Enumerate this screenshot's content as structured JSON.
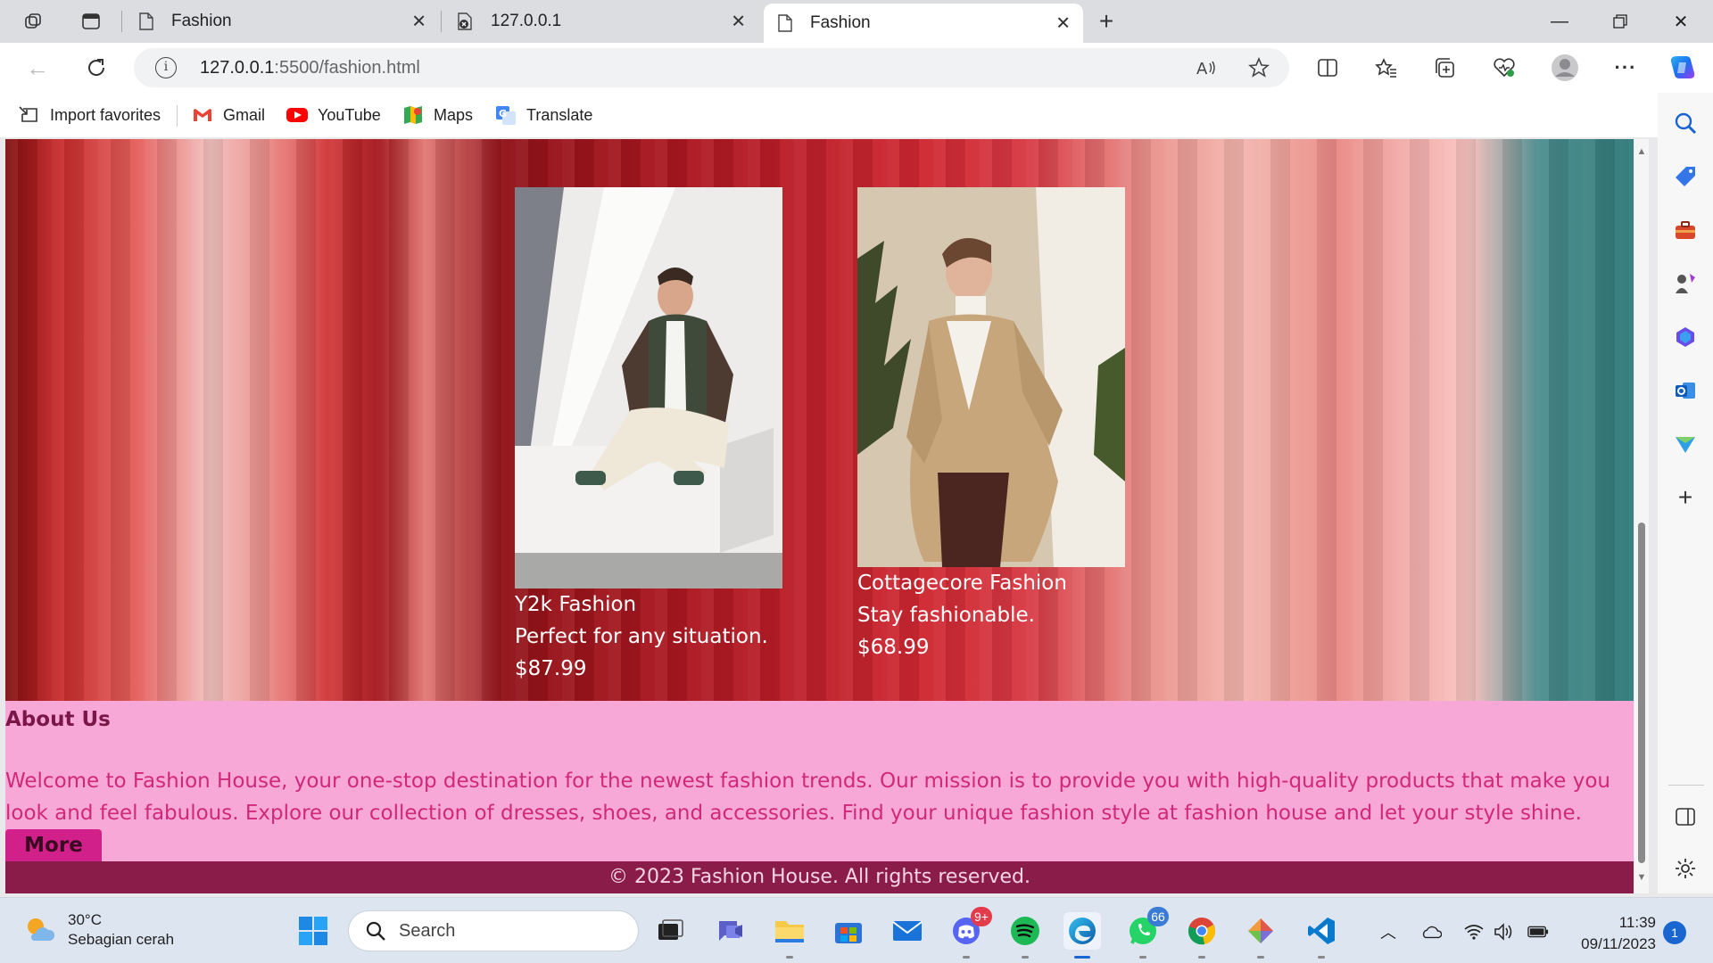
{
  "browser": {
    "tabs": [
      {
        "title": "Fashion",
        "active": false
      },
      {
        "title": "127.0.0.1",
        "active": false
      },
      {
        "title": "Fashion",
        "active": true
      }
    ],
    "address": {
      "host": "127.0.0.1",
      "rest": ":5500/fashion.html"
    },
    "favorites": [
      {
        "label": "Import favorites",
        "icon": "import-favorites-icon"
      },
      {
        "label": "Gmail",
        "icon": "gmail-icon"
      },
      {
        "label": "YouTube",
        "icon": "youtube-icon"
      },
      {
        "label": "Maps",
        "icon": "maps-icon"
      },
      {
        "label": "Translate",
        "icon": "translate-icon"
      }
    ]
  },
  "page": {
    "products": [
      {
        "name": "Y2k Fashion",
        "tagline": "Perfect for any situation.",
        "price": "$87.99"
      },
      {
        "name": "Cottagecore Fashion",
        "tagline": "Stay fashionable.",
        "price": "$68.99"
      }
    ],
    "about": {
      "heading": "About Us",
      "text": "Welcome to Fashion House, your one-stop destination for the newest fashion trends. Our mission is to provide you with high-quality products that make you look and feel fabulous. Explore our collection of dresses, shoes, and accessories. Find your unique fashion style at fashion house and let your style shine.",
      "more_label": "More"
    },
    "footer": "© 2023 Fashion House. All rights reserved."
  },
  "taskbar": {
    "weather": {
      "temp": "30°C",
      "desc": "Sebagian cerah"
    },
    "search_placeholder": "Search",
    "discord_badge": "9+",
    "whatsapp_badge": "66",
    "time": "11:39",
    "date": "09/11/2023",
    "notifications": "1"
  },
  "colors": {
    "about_bg": "#f8a8d6",
    "about_text": "#d0287a",
    "footer_bg": "#8a1c49",
    "more_button": "#d1208a"
  }
}
